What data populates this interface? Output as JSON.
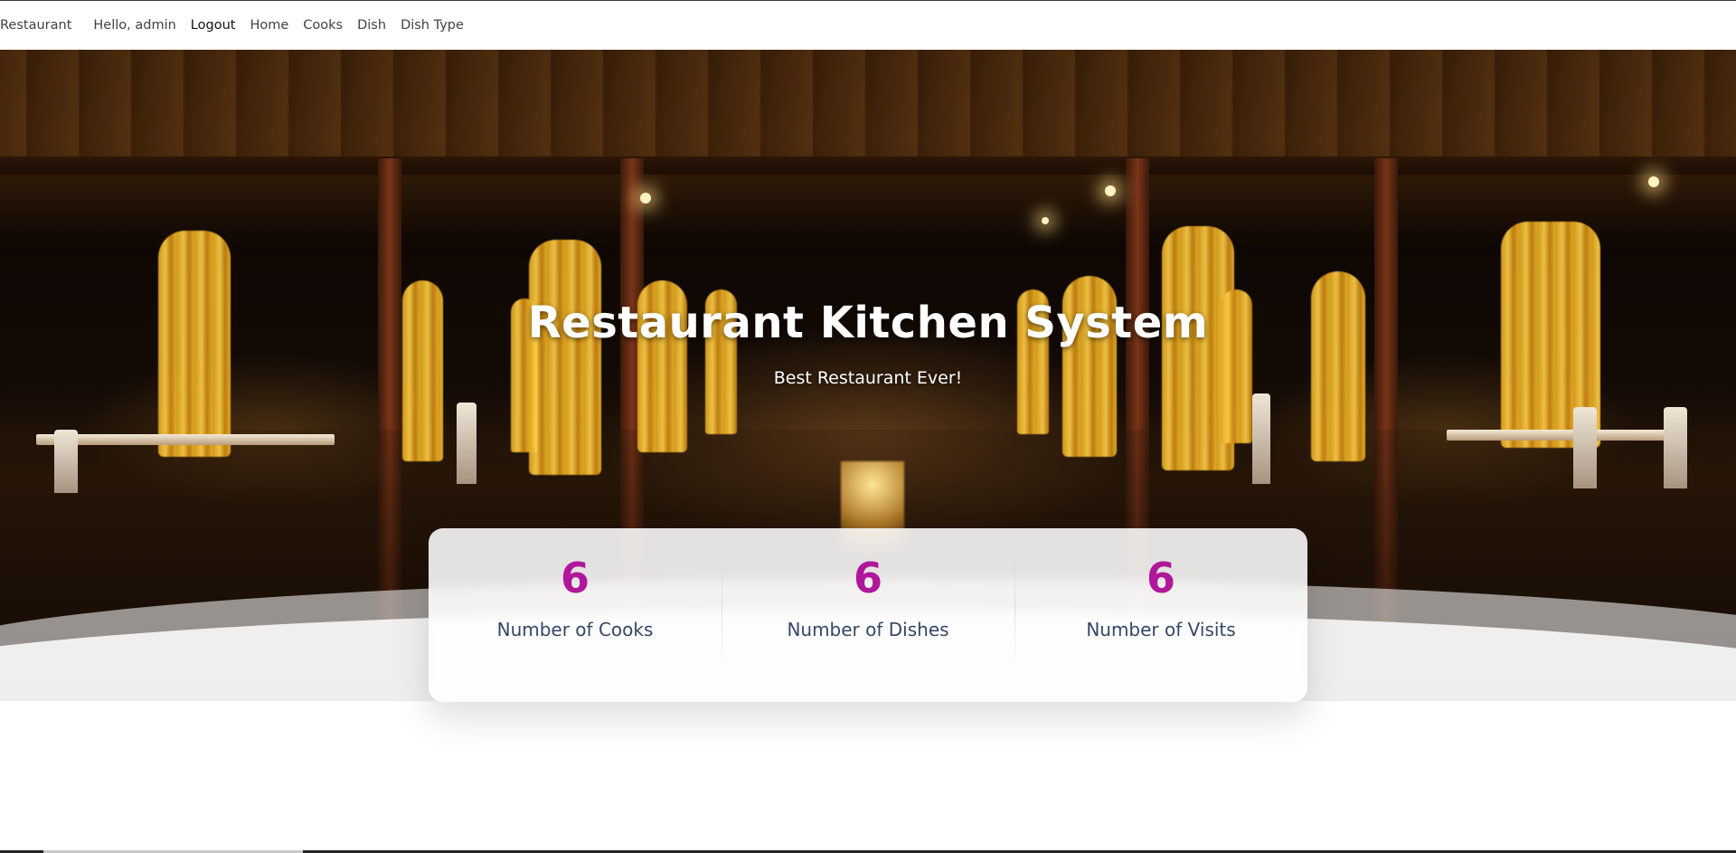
{
  "navbar": {
    "brand": "Restaurant",
    "items": [
      {
        "label": "Hello, admin"
      },
      {
        "label": "Logout"
      },
      {
        "label": "Home"
      },
      {
        "label": "Cooks"
      },
      {
        "label": "Dish"
      },
      {
        "label": "Dish Type"
      }
    ]
  },
  "hero": {
    "title": "Restaurant Kitchen System",
    "subtitle": "Best Restaurant Ever!"
  },
  "stats": [
    {
      "value": "6",
      "label": "Number of Cooks"
    },
    {
      "value": "6",
      "label": "Number of Dishes"
    },
    {
      "value": "6",
      "label": "Number of Visits"
    }
  ],
  "colors": {
    "accent": "#b0179a",
    "stat_label": "#344767"
  }
}
